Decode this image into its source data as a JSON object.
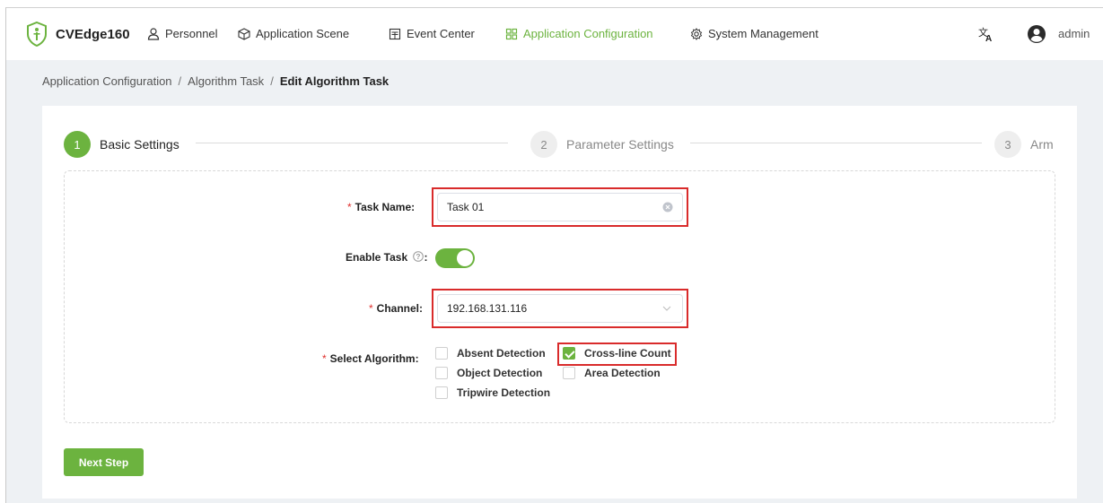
{
  "nav": {
    "brand": "CVEdge160",
    "items": [
      {
        "label": "Personnel",
        "icon": "person-icon"
      },
      {
        "label": "Application Scene",
        "icon": "cube-icon"
      },
      {
        "label": "Event Center",
        "icon": "event-icon"
      },
      {
        "label": "Application Configuration",
        "icon": "grid-icon"
      },
      {
        "label": "System Management",
        "icon": "gear-icon"
      }
    ],
    "user": "admin",
    "accent_color": "#6cb33f"
  },
  "breadcrumb": [
    "Application Configuration",
    "Algorithm Task",
    "Edit Algorithm Task"
  ],
  "steps": [
    {
      "num": "1",
      "label": "Basic Settings"
    },
    {
      "num": "2",
      "label": "Parameter Settings"
    },
    {
      "num": "3",
      "label": "Arm"
    }
  ],
  "form": {
    "task_name_label": "Task Name",
    "task_name_value": "Task 01",
    "enable_task_label": "Enable Task",
    "enable_task_on": true,
    "channel_label": "Channel",
    "channel_value": "192.168.131.116",
    "algorithm_label": "Select Algorithm",
    "algorithms": [
      {
        "label": "Absent Detection",
        "checked": false
      },
      {
        "label": "Cross-line Count",
        "checked": true
      },
      {
        "label": "Object Detection",
        "checked": false
      },
      {
        "label": "Area Detection",
        "checked": false
      },
      {
        "label": "Tripwire Detection",
        "checked": false
      }
    ],
    "colon": ":"
  },
  "actions": {
    "next_label": "Next Step"
  },
  "highlight_color": "#d92b2b"
}
